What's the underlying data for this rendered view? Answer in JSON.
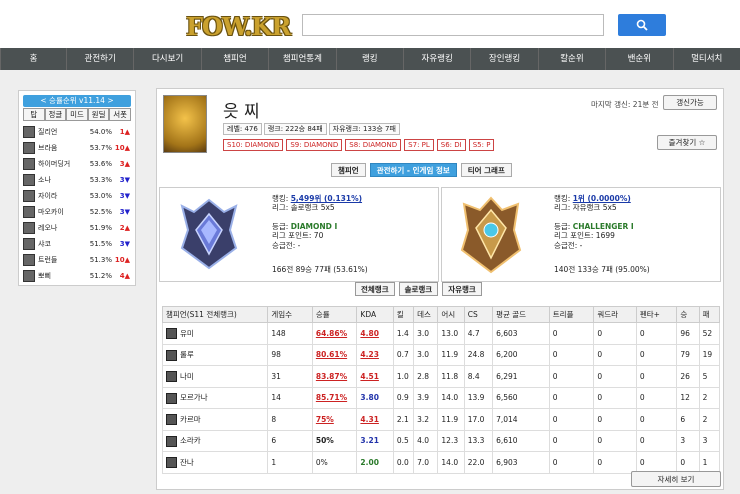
{
  "header": {
    "logo": "FOW.KR",
    "search_placeholder": ""
  },
  "nav": [
    {
      "label": "홈",
      "w": 37
    },
    {
      "label": "관전하기",
      "w": 54
    },
    {
      "label": "다시보기",
      "w": 54
    },
    {
      "label": "챔피언",
      "w": 54
    },
    {
      "label": "챔피언통계",
      "w": 54
    },
    {
      "label": "랭킹",
      "w": 44
    },
    {
      "label": "자유랭킹",
      "w": 54
    },
    {
      "label": "장인랭킹",
      "w": 54
    },
    {
      "label": "칼순위",
      "w": 54
    },
    {
      "label": "밴순위",
      "w": 54
    },
    {
      "label": "멀티서치",
      "w": 54
    }
  ],
  "sidebar": {
    "title": "< 승률순위 v11.14 >",
    "tabs": [
      "탑",
      "정글",
      "미드",
      "원딜",
      "서폿"
    ],
    "rows": [
      {
        "name": "질리언",
        "pct": "54.0%",
        "change": "1",
        "dir": "up"
      },
      {
        "name": "브라움",
        "pct": "53.7%",
        "change": "10",
        "dir": "up"
      },
      {
        "name": "하이머딩거",
        "pct": "53.6%",
        "change": "3",
        "dir": "up"
      },
      {
        "name": "소나",
        "pct": "53.3%",
        "change": "3",
        "dir": "down"
      },
      {
        "name": "자이라",
        "pct": "53.0%",
        "change": "3",
        "dir": "down"
      },
      {
        "name": "마오카이",
        "pct": "52.5%",
        "change": "3",
        "dir": "down"
      },
      {
        "name": "레오나",
        "pct": "51.9%",
        "change": "2",
        "dir": "up"
      },
      {
        "name": "샤코",
        "pct": "51.5%",
        "change": "3",
        "dir": "down"
      },
      {
        "name": "트런들",
        "pct": "51.3%",
        "change": "10",
        "dir": "up"
      },
      {
        "name": "뽀삐",
        "pct": "51.2%",
        "change": "4",
        "dir": "up"
      }
    ]
  },
  "profile": {
    "name": "읏 찌",
    "level": "레벨: 476",
    "rank": "랭크: 222승 84패",
    "flex": "자유랭크: 133승 7패",
    "tiers": [
      "S10: DIAMOND",
      "S9: DIAMOND",
      "S8: DIAMOND",
      "S7: PL",
      "S6: DI",
      "S5: P"
    ],
    "updated": "마지막 갱신: 21분 전",
    "refresh_label": "갱신가능",
    "favorite_label": "즐겨찾기 ☆"
  },
  "tabs": [
    "챔피언",
    "관전하기 - 인게임 정보",
    "티어 그래프"
  ],
  "solo": {
    "rank_label": "랭킹: ",
    "rank_value": "5,499위 (0.131%)",
    "league": "리그: 솔로랭크 5x5",
    "tier": "등급: ",
    "tier_value": "DIAMOND I",
    "points": "리그 포인트: 70",
    "promo": "승급전: -",
    "record": "166전 89승 77패 (53.61%)"
  },
  "flex": {
    "rank_label": "랭킹: ",
    "rank_value": "1위 (0.0000%)",
    "league": "리그: 자유랭크 5x5",
    "tier": "등급: ",
    "tier_value": "CHALLENGER I",
    "points": "리그 포인트: 1699",
    "promo": "승급전: -",
    "record": "140전 133승 7패 (95.00%)"
  },
  "queue_buttons": [
    "전체랭크",
    "솔로랭크",
    "자유랭크"
  ],
  "table": {
    "headers": [
      "챔피언(S11 전체랭크)",
      "게임수",
      "승률",
      "KDA",
      "킬",
      "데스",
      "어시",
      "CS",
      "평균 골드",
      "트리플",
      "쿼드라",
      "펜타+",
      "승",
      "패"
    ],
    "rows": [
      {
        "champ": "유미",
        "games": "148",
        "wr": "64.86%",
        "kda": "4.80",
        "k": "1.4",
        "d": "3.0",
        "a": "13.0",
        "cs": "4.7",
        "gold": "6,603",
        "tri": "0",
        "quad": "0",
        "penta": "0",
        "w": "96",
        "l": "52",
        "wrs": "wr",
        "kdas": "kda1"
      },
      {
        "champ": "룰루",
        "games": "98",
        "wr": "80.61%",
        "kda": "4.23",
        "k": "0.7",
        "d": "3.0",
        "a": "11.9",
        "cs": "24.8",
        "gold": "6,200",
        "tri": "0",
        "quad": "0",
        "penta": "0",
        "w": "79",
        "l": "19",
        "wrs": "wr",
        "kdas": "kda1"
      },
      {
        "champ": "나미",
        "games": "31",
        "wr": "83.87%",
        "kda": "4.51",
        "k": "1.0",
        "d": "2.8",
        "a": "11.8",
        "cs": "8.4",
        "gold": "6,291",
        "tri": "0",
        "quad": "0",
        "penta": "0",
        "w": "26",
        "l": "5",
        "wrs": "wr",
        "kdas": "kda1"
      },
      {
        "champ": "모르가나",
        "games": "14",
        "wr": "85.71%",
        "kda": "3.80",
        "k": "0.9",
        "d": "3.9",
        "a": "14.0",
        "cs": "13.9",
        "gold": "6,560",
        "tri": "0",
        "quad": "0",
        "penta": "0",
        "w": "12",
        "l": "2",
        "wrs": "wr",
        "kdas": "kda2"
      },
      {
        "champ": "카르마",
        "games": "8",
        "wr": "75%",
        "kda": "4.31",
        "k": "2.1",
        "d": "3.2",
        "a": "11.9",
        "cs": "17.0",
        "gold": "7,014",
        "tri": "0",
        "quad": "0",
        "penta": "0",
        "w": "6",
        "l": "2",
        "wrs": "wr",
        "kdas": "kda1"
      },
      {
        "champ": "소라카",
        "games": "6",
        "wr": "50%",
        "kda": "3.21",
        "k": "0.5",
        "d": "4.0",
        "a": "12.3",
        "cs": "13.3",
        "gold": "6,610",
        "tri": "0",
        "quad": "0",
        "penta": "0",
        "w": "3",
        "l": "3",
        "wrs": "wrb",
        "kdas": "kda2"
      },
      {
        "champ": "잔나",
        "games": "1",
        "wr": "0%",
        "kda": "2.00",
        "k": "0.0",
        "d": "7.0",
        "a": "14.0",
        "cs": "22.0",
        "gold": "6,903",
        "tri": "0",
        "quad": "0",
        "penta": "0",
        "w": "0",
        "l": "1",
        "wrs": "",
        "kdas": "kda3"
      }
    ]
  },
  "more_label": "자세히 보기"
}
